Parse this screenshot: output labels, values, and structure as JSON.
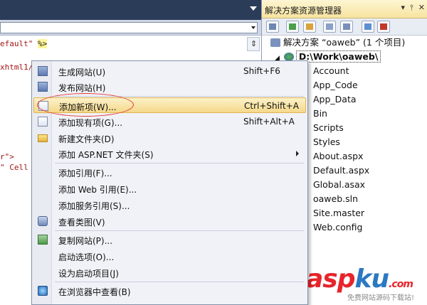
{
  "editor": {
    "code_lines": [
      {
        "pre": "efault\"",
        "tag": "%>"
      },
      {
        "text": "xhtml1/"
      },
      {
        "text": "r\">"
      },
      {
        "text": "\" Cell"
      }
    ]
  },
  "explorer": {
    "title": "解决方案资源管理器",
    "title_buttons": [
      "▾",
      "📌",
      "✕"
    ],
    "solution": "解决方案 “oaweb” (1 个项目)",
    "project": "D:\\Work\\oaweb\\",
    "items": [
      "Account",
      "App_Code",
      "App_Data",
      "Bin",
      "Scripts",
      "Styles",
      "About.aspx",
      "Default.aspx",
      "Global.asax",
      "oaweb.sln",
      "Site.master",
      "Web.config"
    ]
  },
  "menu": {
    "items": [
      {
        "label": "生成网站(U)",
        "shortcut": "Shift+F6",
        "icon": "build-icon"
      },
      {
        "label": "发布网站(H)",
        "shortcut": "",
        "icon": "publish-icon"
      },
      {
        "label": "添加新项(W)...",
        "shortcut": "Ctrl+Shift+A",
        "icon": "add-new-item-icon",
        "highlighted": true
      },
      {
        "label": "添加现有项(G)...",
        "shortcut": "Shift+Alt+A",
        "icon": "add-existing-item-icon"
      },
      {
        "label": "新建文件夹(D)",
        "shortcut": "",
        "icon": "folder-icon"
      },
      {
        "label": "添加 ASP.NET 文件夹(S)",
        "shortcut": "",
        "icon": "",
        "submenu": true
      },
      {
        "label": "添加引用(F)...",
        "shortcut": "",
        "icon": ""
      },
      {
        "label": "添加 Web 引用(E)...",
        "shortcut": "",
        "icon": ""
      },
      {
        "label": "添加服务引用(S)...",
        "shortcut": "",
        "icon": ""
      },
      {
        "label": "查看类图(V)",
        "shortcut": "",
        "icon": "class-diagram-icon"
      },
      {
        "label": "复制网站(P)...",
        "shortcut": "",
        "icon": "copy-website-icon"
      },
      {
        "label": "启动选项(O)...",
        "shortcut": "",
        "icon": ""
      },
      {
        "label": "设为启动项目(J)",
        "shortcut": "",
        "icon": ""
      },
      {
        "label": "在浏览器中查看(B)",
        "shortcut": "",
        "icon": "browser-icon"
      }
    ]
  },
  "watermark": {
    "brand_a": "asp",
    "brand_b": "ku",
    "brand_c": ".com",
    "subtitle": "免费网站源码下载站!"
  },
  "colors": {
    "highlight": "#f5d98a",
    "annotation": "#e23a3a",
    "titlebar": "#2b3c59"
  }
}
